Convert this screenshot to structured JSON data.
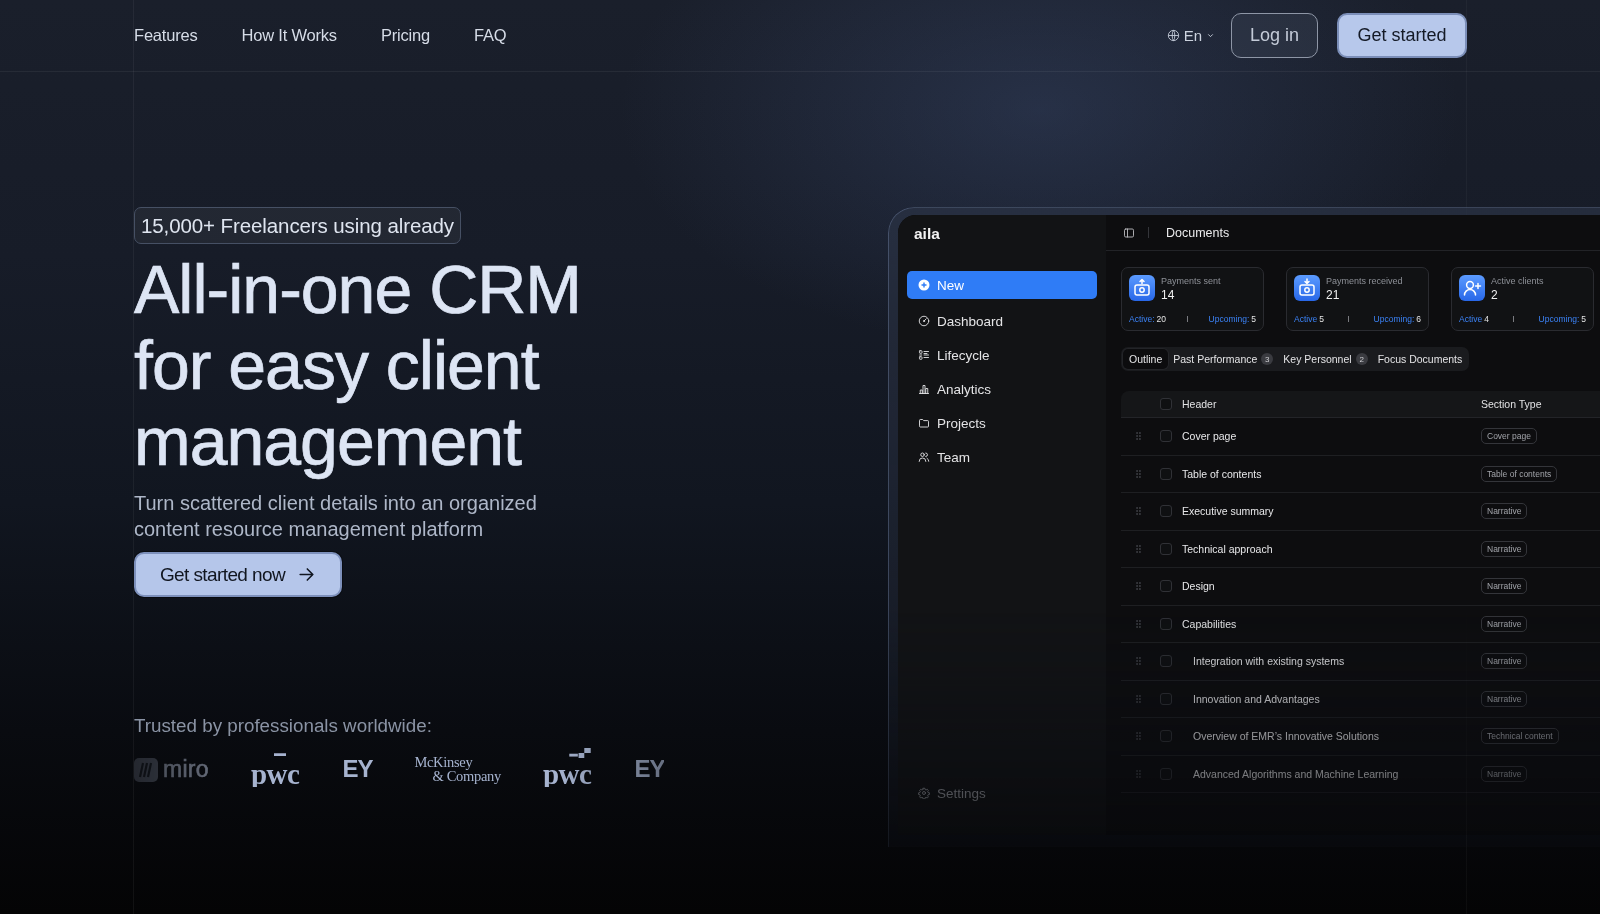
{
  "nav": {
    "links": [
      "Features",
      "How It Works",
      "Pricing",
      "FAQ"
    ],
    "language": "En",
    "login": "Log in",
    "cta": "Get started"
  },
  "hero": {
    "badge": "15,000+ Freelancers using already",
    "title": "All-in-one CRM for easy client management",
    "subtitle": "Turn scattered client details into an organized content resource management platform",
    "cta": "Get started now"
  },
  "trusted": {
    "label": "Trusted by professionals worldwide:",
    "logos": [
      {
        "kind": "miro",
        "text": "miro"
      },
      {
        "kind": "pwc",
        "text": "pwc"
      },
      {
        "kind": "ey",
        "text": "EY"
      },
      {
        "kind": "mckinsey",
        "lines": [
          "McKinsey",
          "& Company"
        ]
      },
      {
        "kind": "pwcblocks",
        "text": "pwc"
      },
      {
        "kind": "ey",
        "text": "EY"
      }
    ]
  },
  "app": {
    "brand": "aila",
    "new_button": "New",
    "sidebar": {
      "items": [
        {
          "kind": "dashboard",
          "label": "Dashboard"
        },
        {
          "kind": "lifecycle",
          "label": "Lifecycle"
        },
        {
          "kind": "analytics",
          "label": "Analytics"
        },
        {
          "kind": "projects",
          "label": "Projects"
        },
        {
          "kind": "team",
          "label": "Team"
        }
      ],
      "footer": [
        {
          "kind": "settings",
          "label": "Settings"
        }
      ]
    },
    "toolbar": {
      "title": "Documents"
    },
    "stats": [
      {
        "kind": "sent",
        "label": "Payments sent",
        "value": "14",
        "footer": [
          {
            "label": "Active:",
            "value": "20"
          },
          {
            "label": "Upcoming:",
            "value": "5"
          }
        ]
      },
      {
        "kind": "received",
        "label": "Payments received",
        "value": "21",
        "footer": [
          {
            "label": "Active",
            "value": "5"
          },
          {
            "label": "Upcoming:",
            "value": "6"
          }
        ]
      },
      {
        "kind": "clients",
        "label": "Active clients",
        "value": "2",
        "footer": [
          {
            "label": "Active",
            "value": "4"
          },
          {
            "label": "Upcoming:",
            "value": "5"
          }
        ]
      }
    ],
    "tabs": [
      {
        "label": "Outline",
        "selected": true
      },
      {
        "label": "Past Performance",
        "count": "3",
        "selected": false
      },
      {
        "label": "Key Personnel",
        "count": "2",
        "selected": false
      },
      {
        "label": "Focus Documents",
        "selected": false
      }
    ],
    "table": {
      "columns": [
        "Header",
        "Section Type"
      ],
      "select_all": {
        "checked": false
      },
      "rows": [
        {
          "header": "Cover page",
          "type": "Cover page",
          "checked": false
        },
        {
          "header": "Table of contents",
          "type": "Table of contents",
          "checked": false
        },
        {
          "header": "Executive summary",
          "type": "Narrative",
          "checked": false
        },
        {
          "header": "Technical approach",
          "type": "Narrative",
          "checked": false
        },
        {
          "header": "Design",
          "type": "Narrative",
          "checked": false
        },
        {
          "header": "Capabilities",
          "type": "Narrative",
          "checked": false,
          "children": [
            {
              "header": "Integration with existing systems",
              "type": "Narrative",
              "checked": false
            },
            {
              "header": "Innovation and Advantages",
              "type": "Narrative",
              "checked": false
            },
            {
              "header": "Overview of EMR’s Innovative Solutions",
              "type": "Technical content",
              "checked": false
            },
            {
              "header": "Advanced Algorithms and Machine Learning",
              "type": "Narrative",
              "checked": false
            }
          ]
        }
      ]
    }
  }
}
